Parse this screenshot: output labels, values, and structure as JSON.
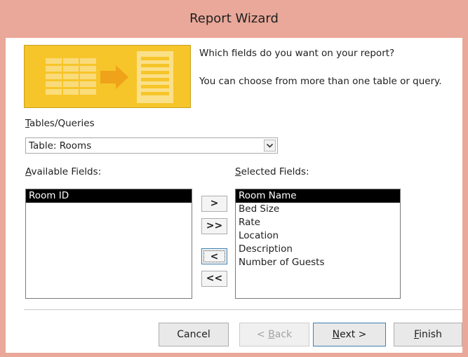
{
  "window": {
    "title": "Report Wizard"
  },
  "prompt": {
    "line1": "Which fields do you want on your report?",
    "line2": "You can choose from more than one table or query."
  },
  "tables_queries": {
    "label_hotkey": "T",
    "label_rest": "ables/Queries",
    "value": "Table: Rooms",
    "dropdown_glyph": "⌄"
  },
  "available_fields": {
    "label_hotkey": "A",
    "label_rest": "vailable Fields:",
    "items": [
      {
        "label": "Room ID",
        "selected": true
      }
    ]
  },
  "selected_fields": {
    "label_hotkey": "S",
    "label_rest": "elected Fields:",
    "items": [
      {
        "label": "Room Name",
        "selected": true
      },
      {
        "label": "Bed Size",
        "selected": false
      },
      {
        "label": "Rate",
        "selected": false
      },
      {
        "label": "Location",
        "selected": false
      },
      {
        "label": "Description",
        "selected": false
      },
      {
        "label": "Number  of Guests",
        "selected": false
      }
    ]
  },
  "move_buttons": {
    "add_one": ">",
    "add_all": ">>",
    "remove_one": "<",
    "remove_all": "<<"
  },
  "buttons": {
    "cancel": "Cancel",
    "back_prefix": "< ",
    "back_hotkey": "B",
    "back_rest": "ack",
    "next_hotkey": "N",
    "next_rest": "ext >",
    "finish_hotkey": "F",
    "finish_rest": "inish"
  },
  "colors": {
    "title_bar": "#e9a899",
    "graphic": "#f6c52a",
    "selection": "#000000",
    "focus_border": "#3c7fb1"
  }
}
